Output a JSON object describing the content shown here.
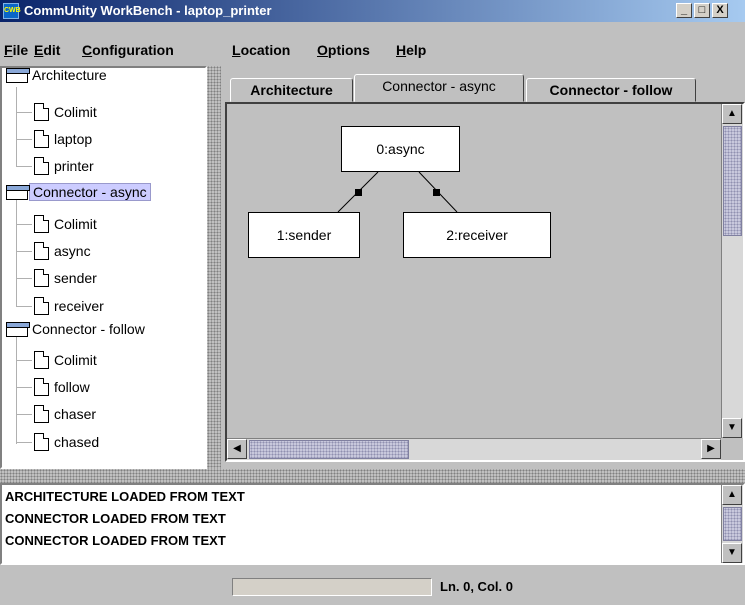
{
  "window": {
    "icon_text": "CWB",
    "title": "CommUnity WorkBench - laptop_printer",
    "minimize": "_",
    "maximize": "□",
    "close": "X"
  },
  "menu": [
    {
      "u": "F",
      "rest": "ile"
    },
    {
      "u": "E",
      "rest": "dit"
    },
    {
      "u": "C",
      "rest": "onfiguration"
    },
    {
      "u": "L",
      "rest": "ocation"
    },
    {
      "u": "O",
      "rest": "ptions"
    },
    {
      "u": "H",
      "rest": "elp"
    }
  ],
  "tree": {
    "groups": [
      {
        "label": "Architecture",
        "children": [
          "Colimit",
          "laptop",
          "printer"
        ],
        "selected": false
      },
      {
        "label": "Connector - async",
        "children": [
          "Colimit",
          "async",
          "sender",
          "receiver"
        ],
        "selected": true
      },
      {
        "label": "Connector - follow",
        "children": [
          "Colimit",
          "follow",
          "chaser",
          "chased"
        ],
        "selected": false
      }
    ]
  },
  "tabs": [
    {
      "label": "Architecture",
      "active": false
    },
    {
      "label": "Connector - async",
      "active": true
    },
    {
      "label": "Connector - follow",
      "active": false
    }
  ],
  "diagram": {
    "nodes": {
      "top": "0:async",
      "left": "1:sender",
      "right": "2:receiver"
    }
  },
  "scroll": {
    "up": "▲",
    "down": "▼",
    "left": "◀",
    "right": "▶"
  },
  "log": {
    "lines": [
      "ARCHITECTURE LOADED FROM TEXT",
      "CONNECTOR LOADED FROM TEXT",
      "CONNECTOR LOADED FROM TEXT"
    ]
  },
  "status": {
    "position": "Ln. 0, Col. 0",
    "progress": 0
  }
}
